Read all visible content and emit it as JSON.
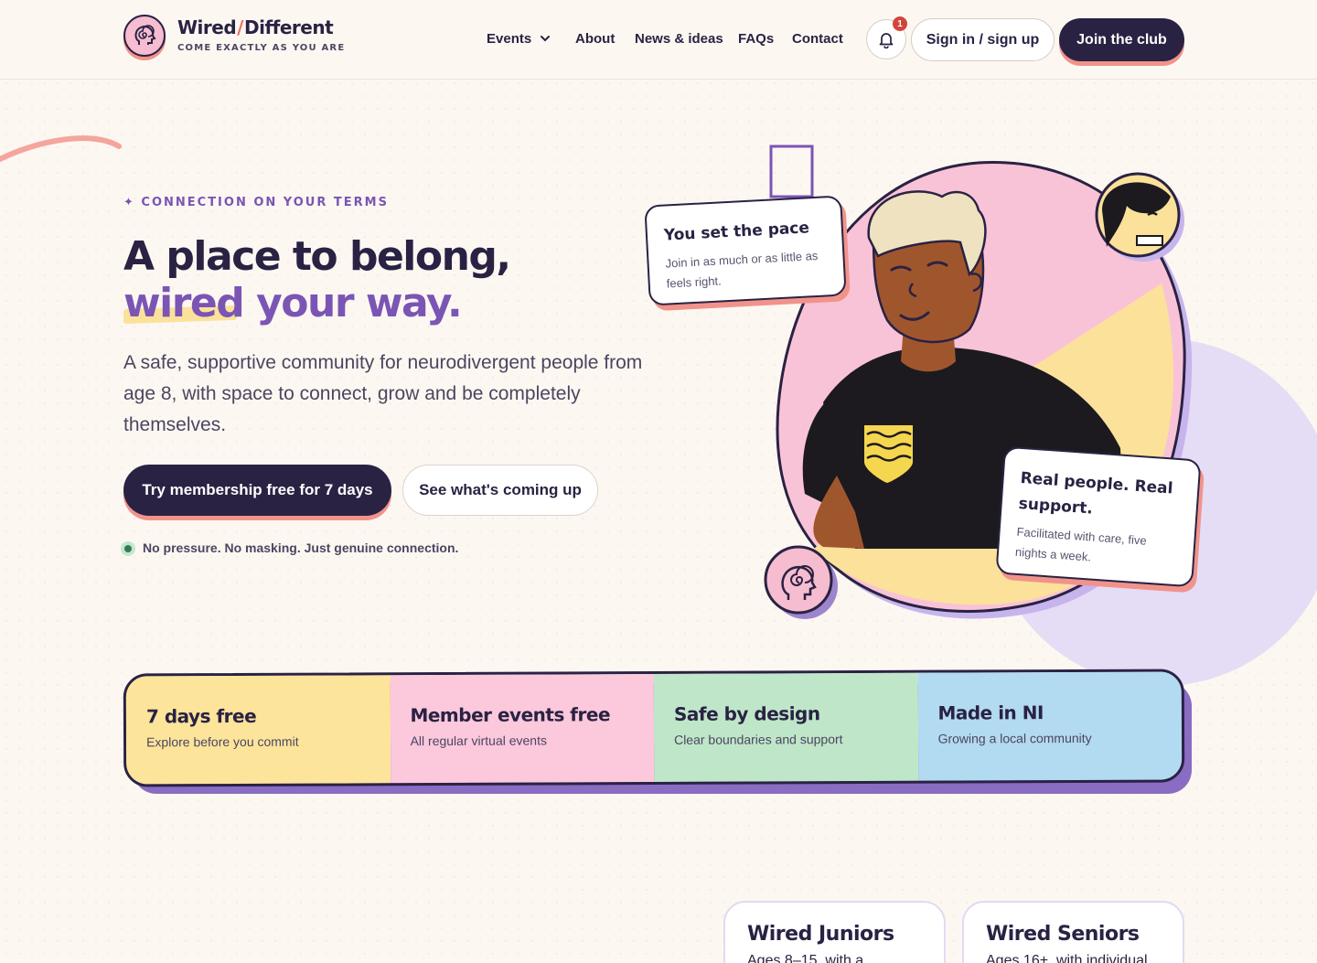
{
  "brand": {
    "name_a": "Wired",
    "slash": "/",
    "name_b": "Different",
    "tagline": "COME EXACTLY AS YOU ARE"
  },
  "nav": {
    "items": [
      "Events",
      "About",
      "News & ideas",
      "FAQs",
      "Contact"
    ],
    "notifications": "1",
    "signin": "Sign in / sign up",
    "join": "Join the club"
  },
  "hero": {
    "eyebrow": "✦ CONNECTION ON YOUR TERMS",
    "title_line1": "A place to belong,",
    "title_line2": "wired your way.",
    "lead": "A safe, supportive community for neurodivergent people from age 8, with space to connect, grow and be completely themselves.",
    "cta_primary": "Try membership free for 7 days",
    "cta_secondary": "See what's coming up",
    "note": "No pressure. No masking. Just genuine connection."
  },
  "cards": [
    {
      "title": "You set the pace",
      "text": "Join in as much or as little as feels right."
    },
    {
      "title": "Real people. Real support.",
      "text": "Facilitated with care, five nights a week."
    }
  ],
  "features": [
    {
      "title": "7 days free",
      "text": "Explore before you commit",
      "color": "#fde49b"
    },
    {
      "title": "Member events free",
      "text": "All regular virtual events",
      "color": "#fbc8dc"
    },
    {
      "title": "Safe by design",
      "text": "Clear boundaries and support",
      "color": "#bfe6c9"
    },
    {
      "title": "Made in NI",
      "text": "Growing a local community",
      "color": "#b2daf1"
    }
  ],
  "groups": [
    {
      "title": "Wired Juniors",
      "text": "Ages 8–15, with a"
    },
    {
      "title": "Wired Seniors",
      "text": "Ages 16+, with individual"
    }
  ],
  "colors": {
    "ink": "#2a2243",
    "accent": "#7a55b4",
    "coral": "#f1938b"
  }
}
